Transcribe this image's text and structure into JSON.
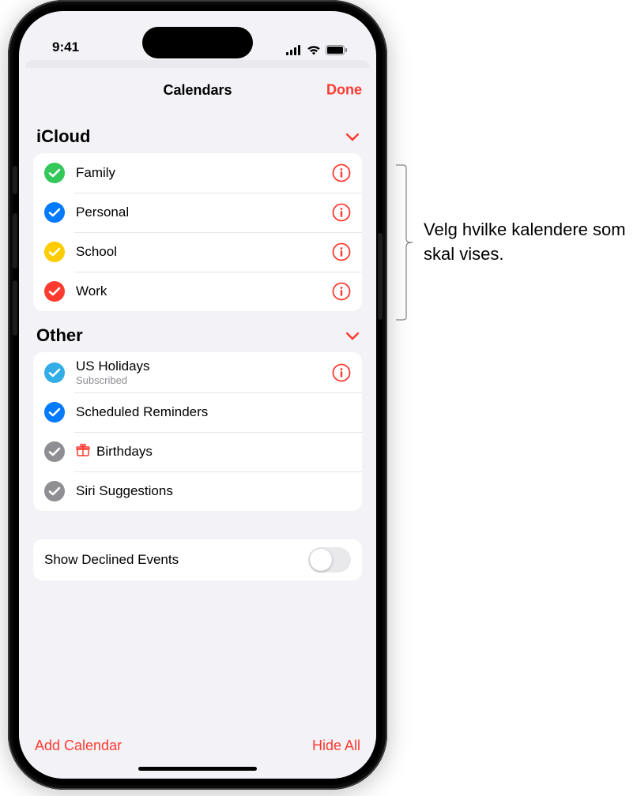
{
  "status": {
    "time": "9:41"
  },
  "sheet": {
    "title": "Calendars",
    "done": "Done"
  },
  "sections": [
    {
      "title": "iCloud",
      "items": [
        {
          "label": "Family",
          "color": "#34c759",
          "info": true
        },
        {
          "label": "Personal",
          "color": "#007aff",
          "info": true
        },
        {
          "label": "School",
          "color": "#ffcc00",
          "info": true
        },
        {
          "label": "Work",
          "color": "#ff3b30",
          "info": true
        }
      ]
    },
    {
      "title": "Other",
      "items": [
        {
          "label": "US Holidays",
          "sub": "Subscribed",
          "color": "#32ade6",
          "info": true
        },
        {
          "label": "Scheduled Reminders",
          "color": "#007aff",
          "info": false
        },
        {
          "label": "Birthdays",
          "color": "#8e8e93",
          "info": false,
          "prefixIcon": "gift"
        },
        {
          "label": "Siri Suggestions",
          "color": "#8e8e93",
          "info": false
        }
      ]
    }
  ],
  "toggle": {
    "label": "Show Declined Events",
    "on": false
  },
  "bottom": {
    "add": "Add Calendar",
    "hide": "Hide All"
  },
  "callout": "Velg hvilke kalendere som skal vises."
}
